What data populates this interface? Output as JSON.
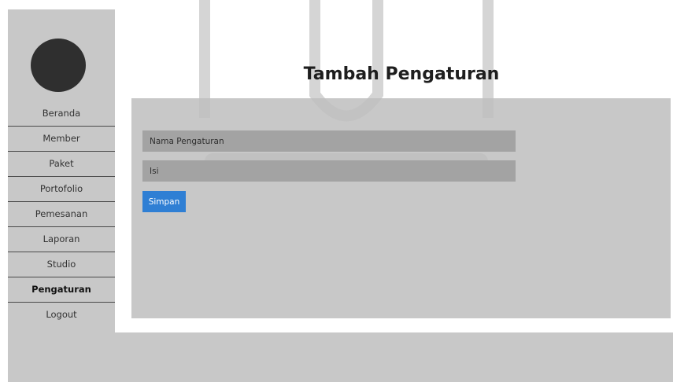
{
  "page_title": "Tambah Pengaturan",
  "sidebar": {
    "items": [
      {
        "label": "Beranda"
      },
      {
        "label": "Member"
      },
      {
        "label": "Paket"
      },
      {
        "label": "Portofolio"
      },
      {
        "label": "Pemesanan"
      },
      {
        "label": "Laporan"
      },
      {
        "label": "Studio"
      },
      {
        "label": "Pengaturan",
        "active": true
      },
      {
        "label": "Logout"
      }
    ]
  },
  "form": {
    "name_placeholder": "Nama Pengaturan",
    "value_placeholder": "Isi",
    "submit_label": "Simpan"
  },
  "colors": {
    "sidebar_bg": "#c8c8c8",
    "avatar": "#2f2f2f",
    "panel_bg": "#bebebe",
    "field_bg": "#a3a3a3",
    "button_bg": "#2f7fd4"
  }
}
